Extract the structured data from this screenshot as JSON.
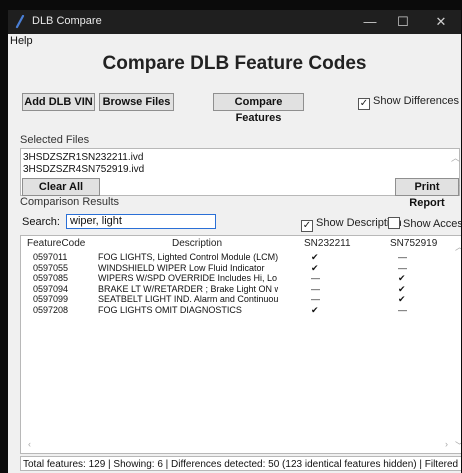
{
  "window": {
    "title": "DLB Compare",
    "controls": {
      "minimize": "—",
      "maximize": "☐",
      "close": "✕"
    }
  },
  "menu": {
    "help": "Help"
  },
  "heading": "Compare DLB Feature Codes",
  "toolbar": {
    "add_vin": "Add DLB VIN",
    "browse": "Browse Files",
    "compare": "Compare Features",
    "show_diff_label": "Show Differences Only",
    "show_diff_checked": true
  },
  "selected_files": {
    "label": "Selected Files",
    "files": [
      "3HSDZSZR1SN232211.ivd",
      "3HSDZSZR4SN752919.ivd"
    ]
  },
  "actions": {
    "clear_all": "Clear All",
    "print_report": "Print Report"
  },
  "results": {
    "label": "Comparison Results",
    "search_label": "Search:",
    "search_value": "wiper, light",
    "show_description_label": "Show Description",
    "show_description_checked": true,
    "show_access_label": "Show Access",
    "show_access_checked": false,
    "columns": [
      "FeatureCode",
      "Description",
      "SN232211",
      "SN752919"
    ],
    "rows": [
      {
        "code": "0597011",
        "desc": "FOG LIGHTS, Lighted Control Module (LCM)",
        "a": "✔",
        "b": "—"
      },
      {
        "code": "0597055",
        "desc": "WINDSHIELD WIPER Low Fluid Indicator",
        "a": "✔",
        "b": "—"
      },
      {
        "code": "0597085",
        "desc": "WIPERS W/SPD OVERRIDE Includes Hi, Lo ar",
        "a": "—",
        "b": "✔"
      },
      {
        "code": "0597094",
        "desc": "BRAKE LT W/RETARDER ; Brake Light ON wi",
        "a": "—",
        "b": "✔"
      },
      {
        "code": "0597099",
        "desc": "SEATBELT LIGHT IND. Alarm and Continuous",
        "a": "—",
        "b": "✔"
      },
      {
        "code": "0597208",
        "desc": "FOG LIGHTS OMIT DIAGNOSTICS",
        "a": "✔",
        "b": "—"
      }
    ]
  },
  "status": "Total features: 129 | Showing: 6 | Differences detected: 50 (123 identical features hidden) | Filtered by: 'wiper, light'"
}
